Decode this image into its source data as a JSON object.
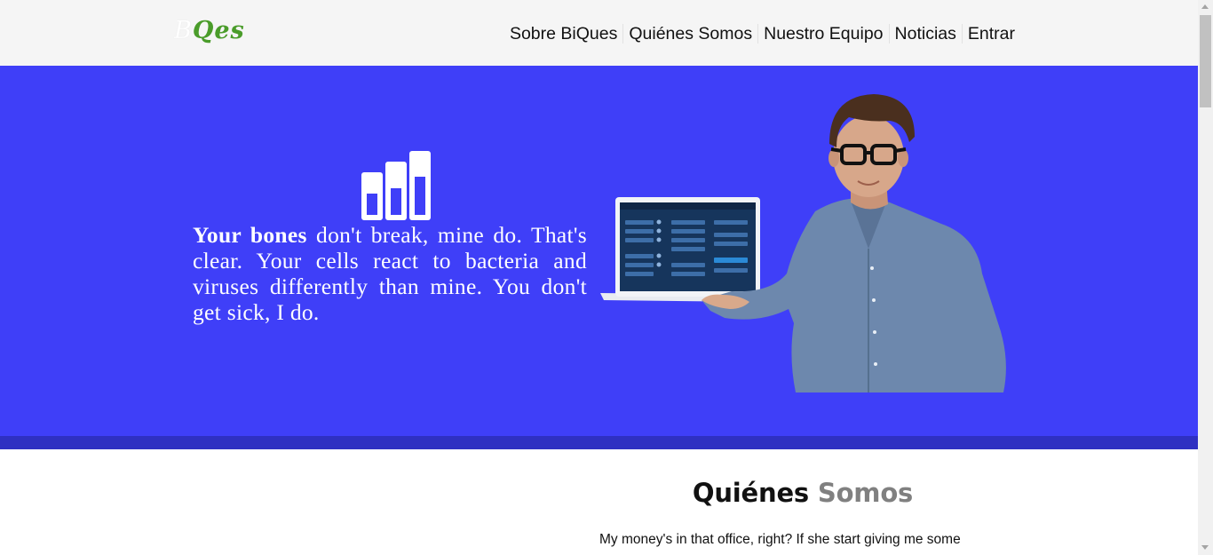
{
  "header": {
    "logo": {
      "part1": "B",
      "part2": "Qes"
    },
    "nav": [
      {
        "label": "Sobre BiQues"
      },
      {
        "label": "Quiénes Somos"
      },
      {
        "label": "Nuestro Equipo"
      },
      {
        "label": "Noticias"
      },
      {
        "label": "Entrar"
      }
    ]
  },
  "hero": {
    "icon": "bar-chart-icon",
    "text_bold": "Your bones",
    "text_rest": " don't break, mine do. That's clear. Your cells react to bacteria and viruses differently than mine. You don't get sick, I do.",
    "bar_levels": [
      0.5,
      0.5,
      0.6
    ]
  },
  "about": {
    "title_part1": "Quiénes",
    "title_part2": "Somos",
    "body": "My money's in that office, right? If she start giving me some"
  },
  "colors": {
    "hero_bg": "#3f3ff8",
    "hero_band": "#2f30c2",
    "header_bg": "#f5f5f5",
    "logo_green": "#4a9c2a"
  }
}
